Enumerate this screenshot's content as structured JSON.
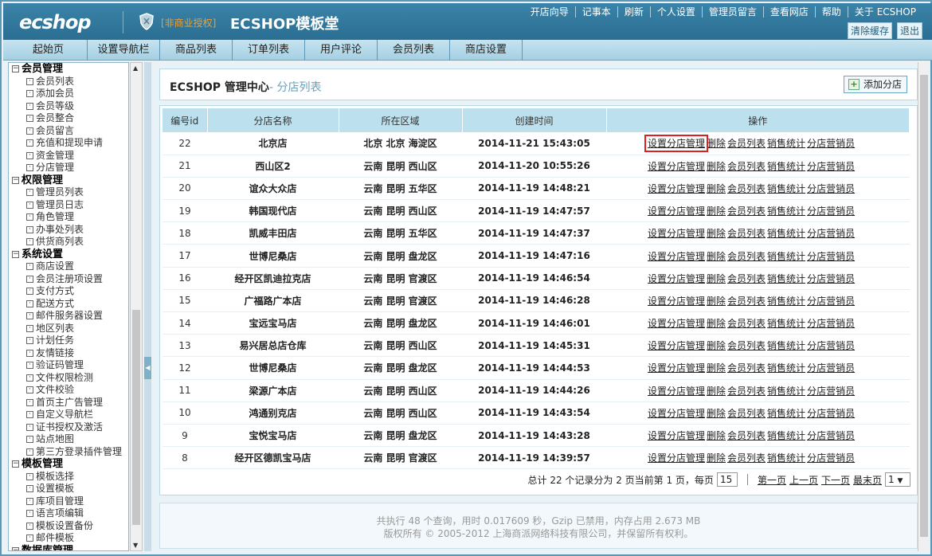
{
  "header": {
    "logo": "ecshop",
    "license": "[非商业授权]",
    "title": "ECSHOP模板堂",
    "links": [
      "开店向导",
      "记事本",
      "刷新",
      "个人设置",
      "管理员留言",
      "查看网店",
      "帮助",
      "关于 ECSHOP"
    ],
    "buttons": [
      "清除缓存",
      "退出"
    ]
  },
  "menu": [
    "起始页",
    "设置导航栏",
    "商品列表",
    "订单列表",
    "用户评论",
    "会员列表",
    "商店设置"
  ],
  "sidebar": [
    {
      "group": "会员管理",
      "items": [
        "会员列表",
        "添加会员",
        "会员等级",
        "会员整合",
        "会员留言",
        "充值和提现申请",
        "资金管理",
        "分店管理"
      ]
    },
    {
      "group": "权限管理",
      "items": [
        "管理员列表",
        "管理员日志",
        "角色管理",
        "办事处列表",
        "供货商列表"
      ]
    },
    {
      "group": "系统设置",
      "items": [
        "商店设置",
        "会员注册项设置",
        "支付方式",
        "配送方式",
        "邮件服务器设置",
        "地区列表",
        "计划任务",
        "友情链接",
        "验证码管理",
        "文件权限检测",
        "文件校验",
        "首页主广告管理",
        "自定义导航栏",
        "证书授权及激活",
        "站点地图",
        "第三方登录插件管理"
      ]
    },
    {
      "group": "模板管理",
      "items": [
        "模板选择",
        "设置模板",
        "库项目管理",
        "语言项编辑",
        "模板设置备份",
        "邮件模板"
      ]
    },
    {
      "group": "数据库管理",
      "items": []
    }
  ],
  "breadcrumb": {
    "main": "ECSHOP 管理中心",
    "sub": "- 分店列表"
  },
  "add_button": "添加分店",
  "table": {
    "headers": [
      "编号id",
      "分店名称",
      "所在区域",
      "创建时间",
      "操作"
    ],
    "ops": [
      "设置分店管理",
      "删除",
      "会员列表",
      "销售统计",
      "分店营销员"
    ],
    "rows": [
      {
        "id": "22",
        "name": "北京店",
        "area": "北京 北京 海淀区",
        "time": "2014-11-21 15:43:05"
      },
      {
        "id": "21",
        "name": "西山区2",
        "area": "云南 昆明 西山区",
        "time": "2014-11-20 10:55:26"
      },
      {
        "id": "20",
        "name": "谊众大众店",
        "area": "云南 昆明 五华区",
        "time": "2014-11-19 14:48:21"
      },
      {
        "id": "19",
        "name": "韩国现代店",
        "area": "云南 昆明 西山区",
        "time": "2014-11-19 14:47:57"
      },
      {
        "id": "18",
        "name": "凯威丰田店",
        "area": "云南 昆明 五华区",
        "time": "2014-11-19 14:47:37"
      },
      {
        "id": "17",
        "name": "世博尼桑店",
        "area": "云南 昆明 盘龙区",
        "time": "2014-11-19 14:47:16"
      },
      {
        "id": "16",
        "name": "经开区凯迪拉克店",
        "area": "云南 昆明 官渡区",
        "time": "2014-11-19 14:46:54"
      },
      {
        "id": "15",
        "name": "广福路广本店",
        "area": "云南 昆明 官渡区",
        "time": "2014-11-19 14:46:28"
      },
      {
        "id": "14",
        "name": "宝远宝马店",
        "area": "云南 昆明 盘龙区",
        "time": "2014-11-19 14:46:01"
      },
      {
        "id": "13",
        "name": "易兴居总店仓库",
        "area": "云南 昆明 西山区",
        "time": "2014-11-19 14:45:31"
      },
      {
        "id": "12",
        "name": "世博尼桑店",
        "area": "云南 昆明 盘龙区",
        "time": "2014-11-19 14:44:53"
      },
      {
        "id": "11",
        "name": "梁源广本店",
        "area": "云南 昆明 西山区",
        "time": "2014-11-19 14:44:26"
      },
      {
        "id": "10",
        "name": "鸿通别克店",
        "area": "云南 昆明 西山区",
        "time": "2014-11-19 14:43:54"
      },
      {
        "id": "9",
        "name": "宝悦宝马店",
        "area": "云南 昆明 盘龙区",
        "time": "2014-11-19 14:43:28"
      },
      {
        "id": "8",
        "name": "经开区德凯宝马店",
        "area": "云南 昆明 官渡区",
        "time": "2014-11-19 14:39:57"
      }
    ]
  },
  "pager": {
    "summary": "总计 22 个记录分为 2 页当前第 1 页，每页",
    "per_page": "15",
    "first": "第一页",
    "prev": "上一页",
    "next": "下一页",
    "last": "最末页",
    "page_select": "1"
  },
  "footer": {
    "line1": "共执行 48 个查询，用时 0.017609 秒，Gzip 已禁用，内存占用 2.673 MB",
    "line2": "版权所有 © 2005-2012 上海商派网络科技有限公司，并保留所有权利。"
  }
}
